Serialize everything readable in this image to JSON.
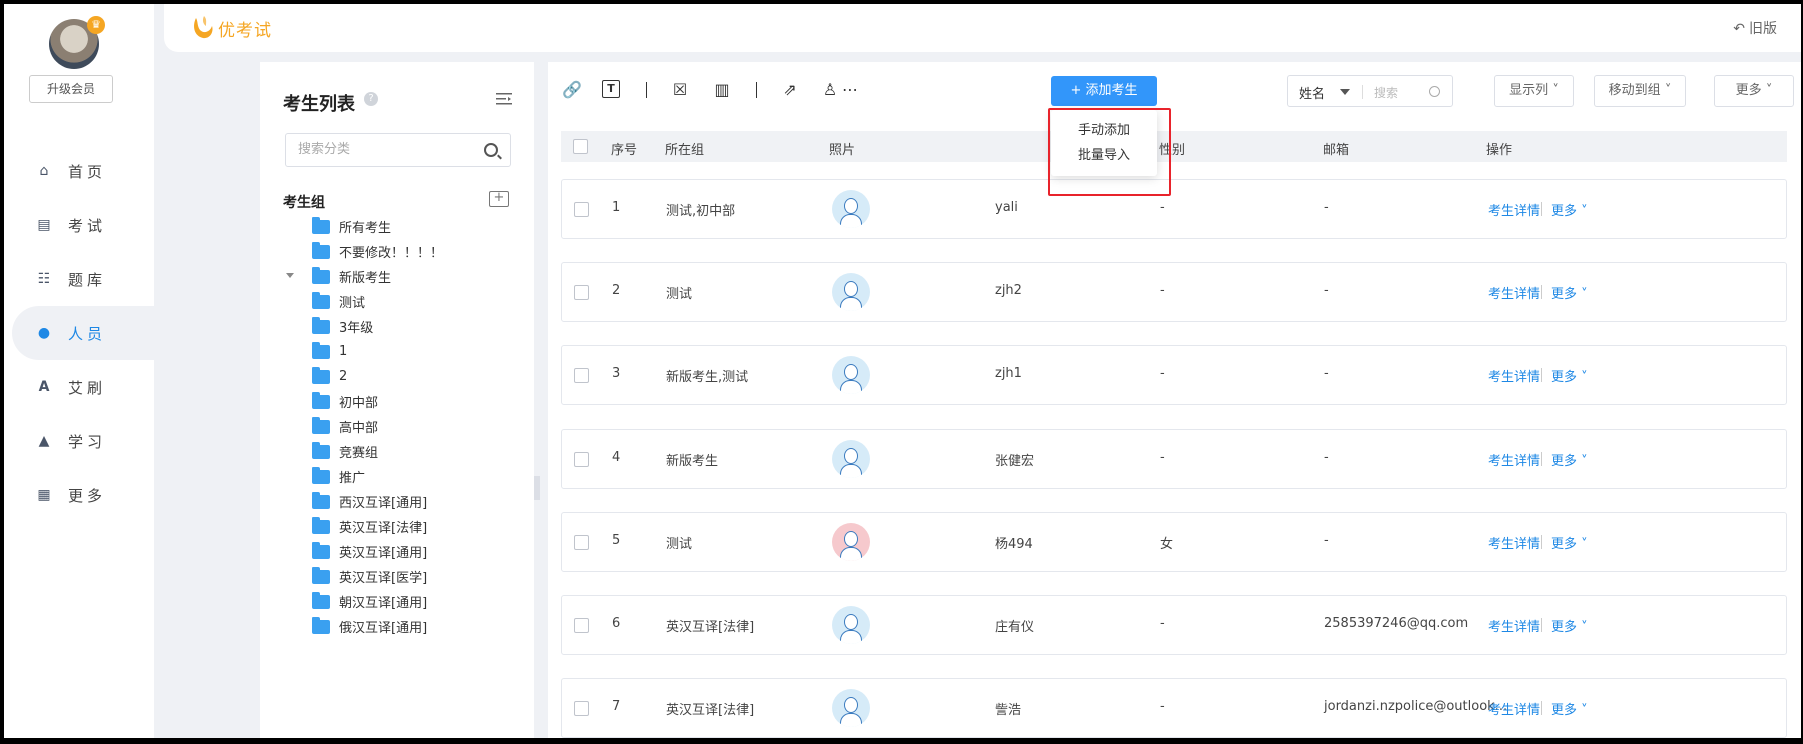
{
  "sidebar": {
    "upgrade_label": "升级会员",
    "nav": [
      {
        "label": "首页",
        "icon": "home-icon",
        "active": false
      },
      {
        "label": "考试",
        "icon": "exam-icon",
        "active": false
      },
      {
        "label": "题库",
        "icon": "question-bank-icon",
        "active": false
      },
      {
        "label": "人员",
        "icon": "person-icon",
        "active": true
      },
      {
        "label": "艾刷",
        "icon": "letter-a-icon",
        "active": false
      },
      {
        "label": "学习",
        "icon": "graduation-cap-icon",
        "active": false
      },
      {
        "label": "更多",
        "icon": "grid-icon",
        "active": false
      }
    ]
  },
  "header": {
    "logo_text": "优考试",
    "old_version": "旧版"
  },
  "groups": {
    "title": "考生列表",
    "search_placeholder": "搜索分类",
    "group_label": "考生组",
    "items": [
      "所有考生",
      "不要修改！！！！",
      "新版考生",
      "测试",
      "3年级",
      "1",
      "2",
      "初中部",
      "高中部",
      "竞赛组",
      "推广",
      "西汉互译[通用]",
      "英汉互译[法律]",
      "英汉互译[通用]",
      "英汉互译[医学]",
      "朝汉互译[通用]",
      "俄汉互译[通用]"
    ]
  },
  "toolbar": {
    "add_button": "添加考生",
    "dropdown": [
      "手动添加",
      "批量导入"
    ],
    "field_select": "姓名",
    "search_placeholder": "搜索",
    "columns_button": "显示列",
    "move_button": "移动到组",
    "more_button": "更多"
  },
  "table": {
    "headers": {
      "index": "序号",
      "group": "所在组",
      "photo": "照片",
      "gender": "性别",
      "email": "邮箱",
      "actions": "操作"
    },
    "detail_label": "考生详情",
    "more_label": "更多",
    "rows": [
      {
        "index": "1",
        "group": "测试,初中部",
        "name": "yali",
        "gender": "-",
        "email": "-",
        "photo": "male"
      },
      {
        "index": "2",
        "group": "测试",
        "name": "zjh2",
        "gender": "-",
        "email": "-",
        "photo": "male"
      },
      {
        "index": "3",
        "group": "新版考生,测试",
        "name": "zjh1",
        "gender": "-",
        "email": "-",
        "photo": "male"
      },
      {
        "index": "4",
        "group": "新版考生",
        "name": "张健宏",
        "gender": "-",
        "email": "-",
        "photo": "male"
      },
      {
        "index": "5",
        "group": "测试",
        "name": "杨494",
        "gender": "女",
        "email": "-",
        "photo": "female"
      },
      {
        "index": "6",
        "group": "英汉互译[法律]",
        "name": "庄有仪",
        "gender": "-",
        "email": "2585397246@qq.com",
        "photo": "male"
      },
      {
        "index": "7",
        "group": "英汉互译[法律]",
        "name": "訾浩",
        "gender": "-",
        "email": "jordanzi.nzpolice@outlook...",
        "photo": "male"
      }
    ]
  },
  "colors": {
    "accent": "#1e88e5",
    "primary_button": "#3296fa",
    "logo": "#f5a623",
    "highlight_box": "#e8232b"
  }
}
